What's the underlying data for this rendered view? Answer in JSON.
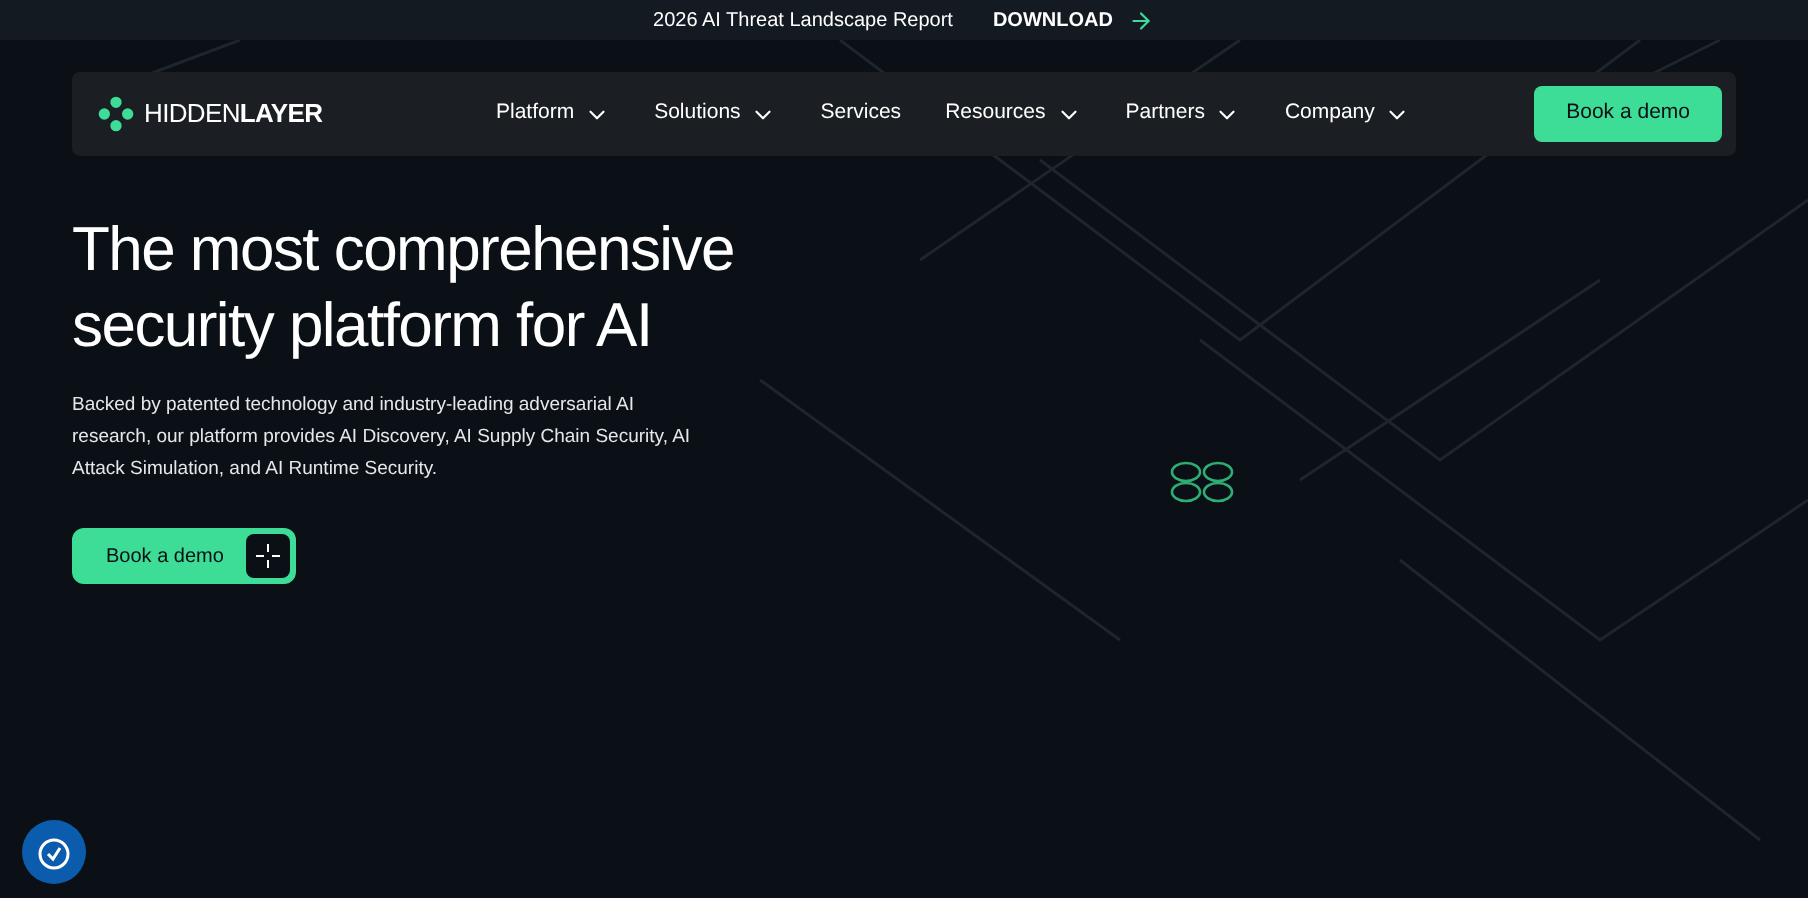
{
  "announcement": {
    "text": "2026 AI Threat Landscape Report",
    "link": "DOWNLOAD"
  },
  "logo": {
    "text": "HIDDEN**LAYER**"
  },
  "nav": [
    {
      "label": "Platform",
      "has_menu": true
    },
    {
      "label": "Solutions",
      "has_menu": true
    },
    {
      "label": "Services",
      "has_menu": false
    },
    {
      "label": "Resources",
      "has_menu": true
    },
    {
      "label": "Partners",
      "has_menu": true
    },
    {
      "label": "Company",
      "has_menu": true
    }
  ],
  "nav_cta": "Book a demo",
  "hero": {
    "title": "The most comprehensive security platform for AI",
    "description": "Backed by patented technology and industry-leading adversarial AI research, our platform provides AI Discovery, AI Supply Chain Security, AI Attack Simulation, and AI Runtime Security.",
    "cta": "Book a demo"
  }
}
